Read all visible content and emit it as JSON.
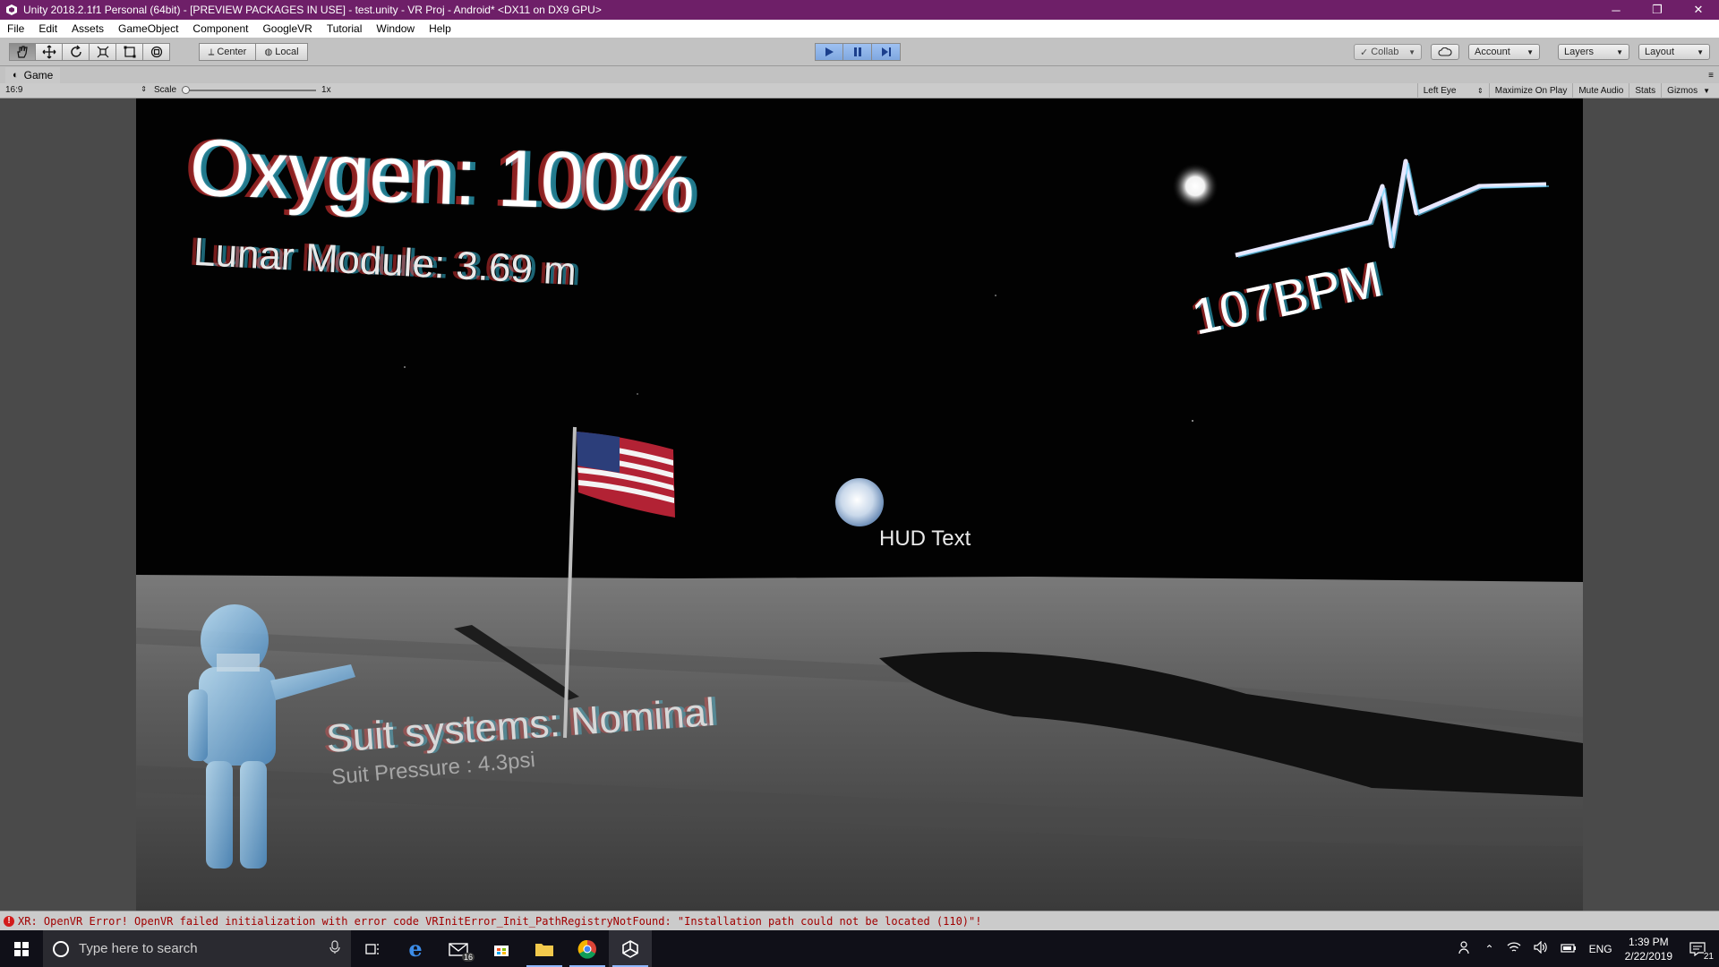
{
  "window": {
    "title": "Unity 2018.2.1f1 Personal (64bit) - [PREVIEW PACKAGES IN USE] - test.unity - VR Proj - Android* <DX11 on DX9 GPU>",
    "minimize": "─",
    "restore": "❐",
    "close": "✕"
  },
  "menu": {
    "items": [
      "File",
      "Edit",
      "Assets",
      "GameObject",
      "Component",
      "GoogleVR",
      "Tutorial",
      "Window",
      "Help"
    ]
  },
  "toolbar": {
    "tools": [
      "hand-icon",
      "move-icon",
      "rotate-icon",
      "scale-icon",
      "rect-icon",
      "transform-icon"
    ],
    "pivot_center": "Center",
    "pivot_local": "Local",
    "collab": "Collab",
    "account": "Account",
    "layers": "Layers",
    "layout": "Layout"
  },
  "game_view": {
    "tab_label": "Game",
    "aspect": "16:9",
    "scale_label": "Scale",
    "scale_value": "1x",
    "options": {
      "eye": "Left Eye",
      "maximize": "Maximize On Play",
      "mute": "Mute Audio",
      "stats": "Stats",
      "gizmos": "Gizmos"
    }
  },
  "hud": {
    "oxygen": "Oxygen: 100%",
    "module": "Lunar Module: 3.69 m",
    "bpm": "107BPM",
    "hud_text": "HUD Text",
    "suit": "Suit systems: Nominal",
    "pressure": "Suit Pressure : 4.3psi"
  },
  "console": {
    "message": "XR: OpenVR Error! OpenVR failed initialization with error code VRInitError_Init_PathRegistryNotFound: \"Installation path could not be located (110)\"!"
  },
  "taskbar": {
    "search_placeholder": "Type here to search",
    "mail_badge": "16",
    "language": "ENG",
    "time": "1:39 PM",
    "date": "2/22/2019",
    "notification_count": "21"
  },
  "colors": {
    "titlebar": "#6e1f68",
    "play_active": "#7fa7e0",
    "console_error": "#a10000"
  }
}
